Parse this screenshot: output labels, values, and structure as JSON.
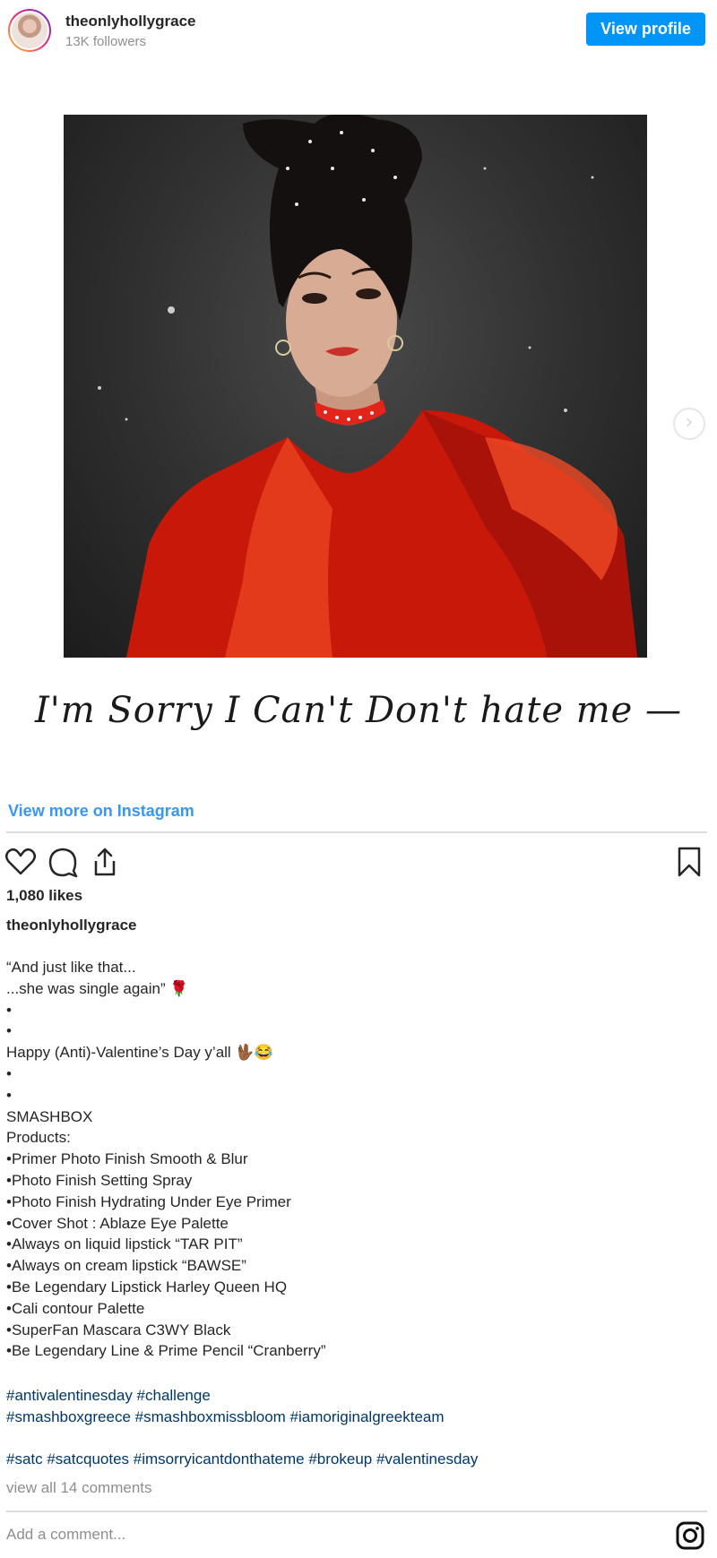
{
  "header": {
    "username": "theonlyhollygrace",
    "followers": "13K followers",
    "view_profile_label": "View profile"
  },
  "media": {
    "script_caption": "I'm Sorry   I Can't   Don't hate me —",
    "next_icon": "chevron-right-icon"
  },
  "view_more_label": "View more on Instagram",
  "actions": {
    "icons": [
      "heart-icon",
      "comment-icon",
      "share-icon",
      "bookmark-icon"
    ]
  },
  "likes": "1,080 likes",
  "post_username": "theonlyhollygrace",
  "caption_lines": [
    "“And just like that...",
    "...she was single again” 🌹",
    "•",
    "•",
    "Happy (Anti)-Valentine’s Day y’all 🖖🏾😂",
    "•",
    "•",
    "SMASHBOX",
    "Products:",
    "•Primer Photo Finish Smooth & Blur",
    "•Photo Finish Setting Spray",
    "•Photo Finish Hydrating Under Eye Primer",
    "•Cover Shot : Ablaze Eye Palette",
    "•Always on liquid lipstick “TAR PIT”",
    "•Always on cream lipstick “BAWSE”",
    "•Be Legendary Lipstick Harley Queen HQ",
    "•Cali contour Palette",
    "•SuperFan Mascara C3WY Black",
    "•Be Legendary Line & Prime Pencil “Cranberry”"
  ],
  "hashtag_lines": [
    "#antivalentinesday #challenge",
    "#smashboxgreece #smashboxmissbloom #iamoriginalgreekteam",
    "#satc #satcquotes #imsorryicantdonthateme #brokeup #valentinesday"
  ],
  "view_comments": "view all 14 comments",
  "add_comment_placeholder": "Add a comment...",
  "footer_icon": "instagram-icon",
  "colors": {
    "accent_blue": "#0095f6",
    "link_blue": "#3897f0",
    "hashtag_blue": "#00376b",
    "muted_gray": "#8e8e8e",
    "dress_red": "#d91e0b"
  }
}
